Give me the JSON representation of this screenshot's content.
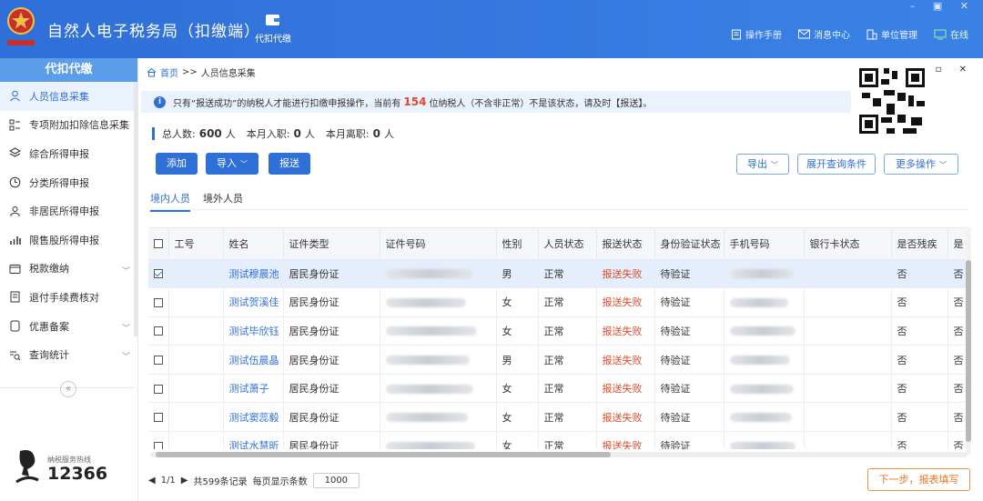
{
  "app": {
    "title": "自然人电子税务局（扣缴端）",
    "module_tab": "代扣代缴",
    "window_controls": "– ▣ ✕",
    "top_links": [
      "操作手册",
      "消息中心",
      "单位管理",
      "在线"
    ]
  },
  "sidebar": {
    "header": "代扣代缴",
    "items": [
      {
        "label": "人员信息采集",
        "icon": "person-icon",
        "active": true,
        "chevron": false
      },
      {
        "label": "专项附加扣除信息采集",
        "icon": "list-grid-icon",
        "active": false,
        "chevron": false
      },
      {
        "label": "综合所得申报",
        "icon": "layers-icon",
        "active": false,
        "chevron": false
      },
      {
        "label": "分类所得申报",
        "icon": "clock-icon",
        "active": false,
        "chevron": false
      },
      {
        "label": "非居民所得申报",
        "icon": "person-outline-icon",
        "active": false,
        "chevron": false
      },
      {
        "label": "限售股所得申报",
        "icon": "bar-chart-icon",
        "active": false,
        "chevron": false
      },
      {
        "label": "税款缴纳",
        "icon": "wallet-icon",
        "active": false,
        "chevron": true
      },
      {
        "label": "退付手续费核对",
        "icon": "document-icon",
        "active": false,
        "chevron": false
      },
      {
        "label": "优惠备案",
        "icon": "file-icon",
        "active": false,
        "chevron": true
      },
      {
        "label": "查询统计",
        "icon": "search-list-icon",
        "active": false,
        "chevron": true
      }
    ],
    "collapse": "«",
    "hotline_label": "纳税服务热线",
    "hotline_number": "12366"
  },
  "main": {
    "breadcrumb_home": "首页",
    "breadcrumb_sep": ">>",
    "breadcrumb_current": "人员信息采集",
    "window_controls": "▫ ✕",
    "notice_pre": "只有“报送成功”的纳税人才能进行扣缴申报操作，当前有",
    "notice_count": "154",
    "notice_post": "位纳税人（不含非正常）不是该状态，请及时【报送】。",
    "stats": {
      "total_label": "总人数:",
      "total_value": "600",
      "unit": "人",
      "join_label": "本月入职:",
      "join_value": "0",
      "leave_label": "本月离职:",
      "leave_value": "0"
    },
    "buttons": {
      "add": "添加",
      "import": "导入",
      "submit": "报送",
      "export": "导出",
      "expand_query": "展开查询条件",
      "more_ops": "更多操作"
    },
    "tabs": [
      "境内人员",
      "境外人员"
    ],
    "table": {
      "columns": [
        "工号",
        "姓名",
        "证件类型",
        "证件号码",
        "性别",
        "人员状态",
        "报送状态",
        "身份验证状态",
        "手机号码",
        "银行卡状态",
        "是否残疾",
        "是"
      ],
      "rows": [
        {
          "checked": true,
          "name": "测试穆晨池",
          "id_type": "居民身份证",
          "gender": "男",
          "status": "正常",
          "submit_status": "报送失败",
          "verify_status": "待验证",
          "disabled": "否",
          "extra": "否"
        },
        {
          "checked": false,
          "name": "测试贺溪佳",
          "id_type": "居民身份证",
          "gender": "女",
          "status": "正常",
          "submit_status": "报送失败",
          "verify_status": "待验证",
          "disabled": "否",
          "extra": "否"
        },
        {
          "checked": false,
          "name": "测试毕欣钰",
          "id_type": "居民身份证",
          "gender": "女",
          "status": "正常",
          "submit_status": "报送失败",
          "verify_status": "待验证",
          "disabled": "否",
          "extra": "否"
        },
        {
          "checked": false,
          "name": "测试伍晨晶",
          "id_type": "居民身份证",
          "gender": "男",
          "status": "正常",
          "submit_status": "报送失败",
          "verify_status": "待验证",
          "disabled": "否",
          "extra": "否"
        },
        {
          "checked": false,
          "name": "测试萧子",
          "id_type": "居民身份证",
          "gender": "女",
          "status": "正常",
          "submit_status": "报送失败",
          "verify_status": "待验证",
          "disabled": "否",
          "extra": "否"
        },
        {
          "checked": false,
          "name": "测试窦蕊毅",
          "id_type": "居民身份证",
          "gender": "女",
          "status": "正常",
          "submit_status": "报送失败",
          "verify_status": "待验证",
          "disabled": "否",
          "extra": "否"
        },
        {
          "checked": false,
          "name": "测试水慧昕",
          "id_type": "居民身份证",
          "gender": "女",
          "status": "正常",
          "submit_status": "报送失败",
          "verify_status": "待验证",
          "disabled": "否",
          "extra": "否"
        }
      ]
    },
    "pager": {
      "page": "1/1",
      "total": "共599条记录",
      "per_page_label": "每页显示条数",
      "per_page_value": "1000"
    },
    "next_button": "下一步，报表填写"
  },
  "colors": {
    "brand_blue": "#2f6fd8",
    "fail_red": "#e24a2a",
    "next_orange": "#e8762a"
  }
}
